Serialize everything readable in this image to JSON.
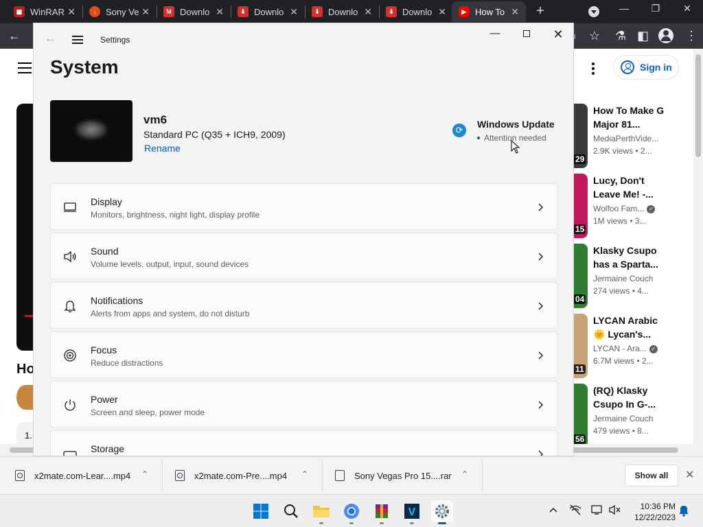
{
  "browser": {
    "tabs": [
      {
        "label": "WinRAR",
        "favicon": "winrar-icon",
        "color": "#b71c1c"
      },
      {
        "label": "Sony Ve",
        "favicon": "download-circle-icon",
        "color": "#e64a19"
      },
      {
        "label": "Downlo",
        "favicon": "gmail-m-icon",
        "color": "#d32f2f"
      },
      {
        "label": "Downlo",
        "favicon": "download-icon",
        "color": "#d32f2f"
      },
      {
        "label": "Downlo",
        "favicon": "download-icon",
        "color": "#d32f2f"
      },
      {
        "label": "Downlo",
        "favicon": "download-icon",
        "color": "#d32f2f"
      },
      {
        "label": "How To",
        "favicon": "youtube-icon",
        "color": "#ff0000"
      }
    ],
    "toolbar_icons": [
      "back-arrow-icon",
      "cast-icon",
      "bookmark-star-icon",
      "extensions-icon",
      "sidebar-icon",
      "profile-icon",
      "menu-kebab-icon"
    ]
  },
  "youtube": {
    "signin_label": "Sign in",
    "video_title_fragment": "Ho",
    "description_fragment": "1.",
    "accent": "#065fd4",
    "recommendations": [
      {
        "title": "How To Make G Major 81...",
        "channel": "MediaPerthVide...",
        "verified": false,
        "views": "2.9K views",
        "age": "2...",
        "duration": "29",
        "thumb_color": "#3a3a3a"
      },
      {
        "title": "Lucy, Don't Leave Me! -...",
        "channel": "Wolfoo Fam...",
        "verified": true,
        "views": "1M views",
        "age": "3...",
        "duration": "15",
        "thumb_color": "#c2185b"
      },
      {
        "title": "Klasky Csupo has a Sparta...",
        "channel": "Jermaine Couch",
        "verified": false,
        "views": "274 views",
        "age": "4...",
        "duration": "04",
        "thumb_color": "#2e7d32"
      },
      {
        "title": "LYCAN Arabic 🌞 Lycan's...",
        "channel": "LYCAN - Ara...",
        "verified": true,
        "views": "6.7M views",
        "age": "2...",
        "duration": "11",
        "thumb_color": "#c8a37a"
      },
      {
        "title": "(RQ) Klasky Csupo In G-...",
        "channel": "Jermaine Couch",
        "verified": false,
        "views": "479 views",
        "age": "8...",
        "duration": "56",
        "thumb_color": "#2e7d32"
      }
    ]
  },
  "settings": {
    "app_name": "Settings",
    "page_title": "System",
    "device": {
      "name": "vm6",
      "model": "Standard PC (Q35 + ICH9, 2009)",
      "rename_label": "Rename"
    },
    "windows_update": {
      "title": "Windows Update",
      "status": "Attention needed"
    },
    "items": [
      {
        "title": "Display",
        "desc": "Monitors, brightness, night light, display profile",
        "icon": "monitor-icon"
      },
      {
        "title": "Sound",
        "desc": "Volume levels, output, input, sound devices",
        "icon": "speaker-icon"
      },
      {
        "title": "Notifications",
        "desc": "Alerts from apps and system, do not disturb",
        "icon": "bell-icon"
      },
      {
        "title": "Focus",
        "desc": "Reduce distractions",
        "icon": "focus-icon"
      },
      {
        "title": "Power",
        "desc": "Screen and sleep, power mode",
        "icon": "power-icon"
      },
      {
        "title": "Storage",
        "desc": "",
        "icon": "storage-icon"
      }
    ],
    "accent": "#005fb8"
  },
  "downloads": {
    "items": [
      {
        "name": "x2mate.com-Lear....mp4",
        "icon": "video-file-icon"
      },
      {
        "name": "x2mate.com-Pre....mp4",
        "icon": "video-file-icon"
      },
      {
        "name": "Sony Vegas Pro 15....rar",
        "icon": "document-file-icon"
      }
    ],
    "show_all_label": "Show all"
  },
  "taskbar": {
    "apps": [
      "windows-start-icon",
      "search-icon",
      "file-explorer-icon",
      "chrome-icon",
      "winrar-icon",
      "vegas-icon",
      "settings-gear-icon"
    ],
    "active_app": "settings-gear-icon",
    "tray": [
      "chevron-up-icon",
      "network-off-icon",
      "display-icon",
      "volume-muted-icon"
    ],
    "time": "10:36 PM",
    "date": "12/22/2023"
  }
}
